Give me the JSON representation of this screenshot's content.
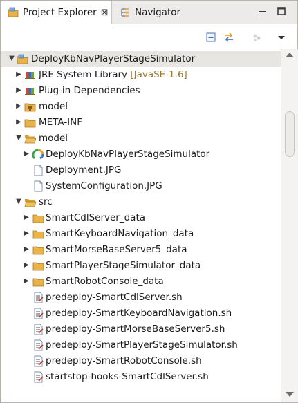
{
  "tabs": {
    "project_explorer": {
      "label": "Project Explorer",
      "icon": "project-explorer-icon",
      "close": "⊠"
    },
    "navigator": {
      "label": "Navigator",
      "icon": "navigator-icon"
    }
  },
  "window_controls": {
    "minimize": "minimize-icon",
    "maximize": "maximize-icon"
  },
  "toolbar": {
    "buttons": [
      "collapse-all-icon",
      "link-with-editor-icon",
      "focus-icon",
      "view-menu-icon"
    ]
  },
  "tree": {
    "project": "DeployKbNavPlayerStageSimulator",
    "items": [
      {
        "label": "JRE System Library",
        "decoration": "[JavaSE-1.6]",
        "icon": "library-icon"
      },
      {
        "label": "Plug-in Dependencies",
        "icon": "library-icon"
      },
      {
        "label": "model",
        "icon": "package-folder-icon"
      },
      {
        "label": "META-INF",
        "icon": "folder-icon"
      },
      {
        "label": "model",
        "icon": "folder-icon"
      },
      {
        "label": "DeployKbNavPlayerStageSimulator",
        "icon": "model-icon"
      },
      {
        "label": "Deployment.JPG",
        "icon": "file-icon"
      },
      {
        "label": "SystemConfiguration.JPG",
        "icon": "file-icon"
      },
      {
        "label": "src",
        "icon": "folder-icon"
      },
      {
        "label": "SmartCdlServer_data",
        "icon": "folder-icon"
      },
      {
        "label": "SmartKeyboardNavigation_data",
        "icon": "folder-icon"
      },
      {
        "label": "SmartMorseBaseServer5_data",
        "icon": "folder-icon"
      },
      {
        "label": "SmartPlayerStageSimulator_data",
        "icon": "folder-icon"
      },
      {
        "label": "SmartRobotConsole_data",
        "icon": "folder-icon"
      },
      {
        "label": "predeploy-SmartCdlServer.sh",
        "icon": "script-icon"
      },
      {
        "label": "predeploy-SmartKeyboardNavigation.sh",
        "icon": "script-icon"
      },
      {
        "label": "predeploy-SmartMorseBaseServer5.sh",
        "icon": "script-icon"
      },
      {
        "label": "predeploy-SmartPlayerStageSimulator.sh",
        "icon": "script-icon"
      },
      {
        "label": "predeploy-SmartRobotConsole.sh",
        "icon": "script-icon"
      },
      {
        "label": "startstop-hooks-SmartCdlServer.sh",
        "icon": "script-icon"
      }
    ]
  },
  "colors": {
    "folder": "#e9b34a",
    "selection": "#e7e6e3",
    "decoration": "#9a7a2b"
  }
}
